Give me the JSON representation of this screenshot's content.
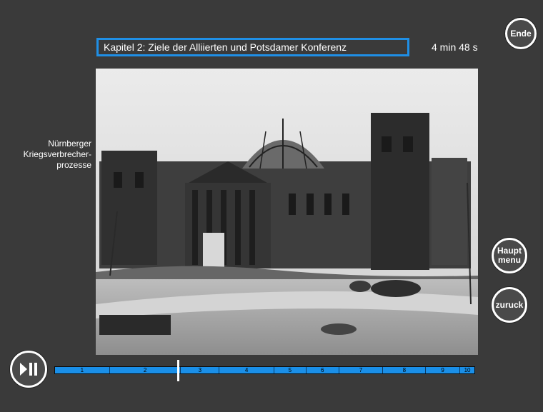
{
  "header": {
    "chapter_title": "Kapitel 2: Ziele der Alliierten und Potsdamer Konferenz",
    "duration_min": "4 min",
    "duration_sec": "48 s"
  },
  "buttons": {
    "ende": "Ende",
    "haupt_line1": "Haupt",
    "haupt_line2": "menu",
    "zuruck": "zuruck"
  },
  "side_label": {
    "line1": "Nürnberger",
    "line2": "Kriegsverbrecher-",
    "line3": "prozesse"
  },
  "timeline": {
    "segments": [
      "1",
      "2",
      "3",
      "4",
      "5",
      "6",
      "7",
      "8",
      "9",
      "10"
    ],
    "progress_fraction": 0.3
  }
}
